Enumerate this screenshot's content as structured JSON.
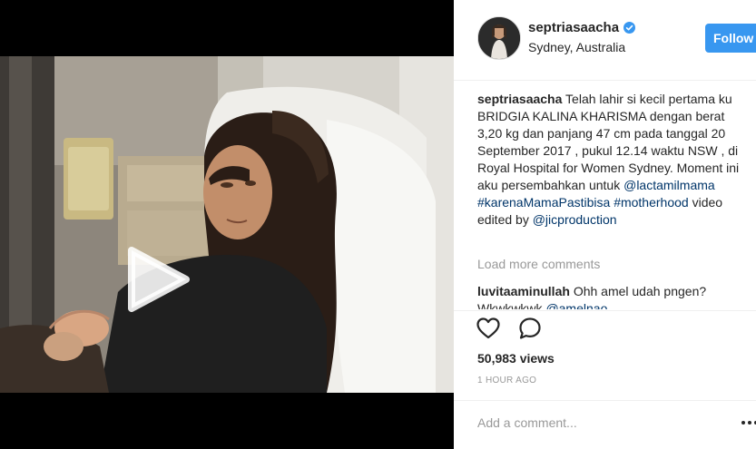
{
  "media": {
    "type": "video",
    "play_icon": "play-icon"
  },
  "post": {
    "username": "septriasaacha",
    "verified_icon": "verified-badge-icon",
    "location": "Sydney, Australia",
    "follow_label": "Follow"
  },
  "caption": {
    "username": "septriasaacha",
    "text": "Telah lahir si kecil pertama ku BRIDGIA KALINA KHARISMA dengan berat 3,20 kg dan panjang 47 cm pada tanggal 20 September 2017 , pukul 12.14 waktu NSW , di Royal Hospital for Women Sydney. Moment ini aku persembahkan untuk",
    "mention_1": "@lactamilmama",
    "hashtag_1": "#karenaMamaPastibisa",
    "hashtag_2": "#motherhood",
    "text_2": "video edited by",
    "mention_2": "@jicproduction"
  },
  "load_more_label": "Load more comments",
  "comments": [
    {
      "username": "luvitaaminullah",
      "text": "Ohh amel udah pngen? Wkwkwkwk",
      "mention": "@amelnao"
    }
  ],
  "actions": {
    "like_icon": "heart-icon",
    "comment_icon": "comment-icon"
  },
  "views": "50,983 views",
  "time_ago": "1 HOUR AGO",
  "add_comment": {
    "placeholder": "Add a comment...",
    "more_icon": "more-dots-icon"
  },
  "colors": {
    "follow_button": "#3897f0",
    "link": "#003569",
    "muted": "#999999",
    "verified": "#3897f0"
  }
}
